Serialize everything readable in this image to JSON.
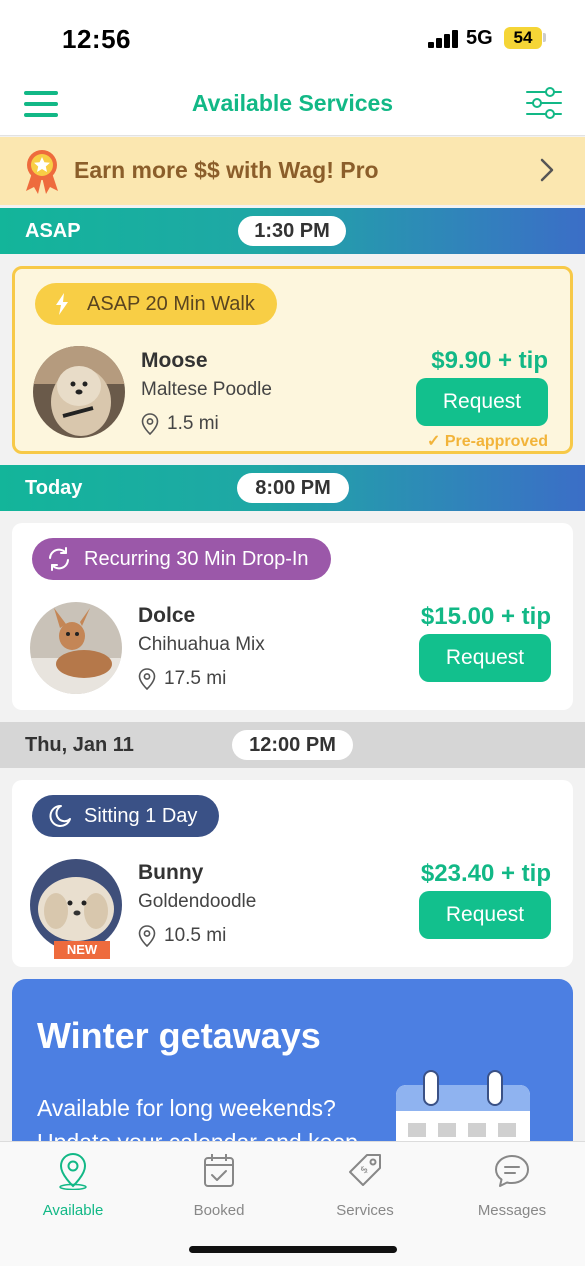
{
  "status_bar": {
    "time": "12:56",
    "network": "5G",
    "battery": "54"
  },
  "header": {
    "title": "Available Services"
  },
  "promo": {
    "text": "Earn more $$ with Wag! Pro"
  },
  "sections": [
    {
      "label": "ASAP",
      "time": "1:30 PM",
      "card": {
        "service": "ASAP 20 Min Walk",
        "dog_name": "Moose",
        "breed": "Maltese Poodle",
        "distance": "1.5 mi",
        "price": "$9.90 + tip",
        "button": "Request",
        "status": "✓ Pre-approved"
      }
    },
    {
      "label": "Today",
      "time": "8:00 PM",
      "card": {
        "service": "Recurring 30 Min Drop-In",
        "dog_name": "Dolce",
        "breed": "Chihuahua Mix",
        "distance": "17.5 mi",
        "price": "$15.00 + tip",
        "button": "Request"
      }
    },
    {
      "label": "Thu, Jan 11",
      "time": "12:00 PM",
      "card": {
        "service": "Sitting 1 Day",
        "dog_name": "Bunny",
        "breed": "Goldendoodle",
        "distance": "10.5 mi",
        "price": "$23.40 + tip",
        "button": "Request",
        "badge": "NEW"
      }
    }
  ],
  "winter_promo": {
    "title": "Winter getaways",
    "body": "Available for long weekends? Update your calendar and keep"
  },
  "tabs": [
    {
      "label": "Available",
      "icon": "map-pin-icon",
      "active": true
    },
    {
      "label": "Booked",
      "icon": "calendar-check-icon",
      "active": false
    },
    {
      "label": "Services",
      "icon": "price-tag-icon",
      "active": false
    },
    {
      "label": "Messages",
      "icon": "chat-bubble-icon",
      "active": false
    }
  ],
  "colors": {
    "brand": "#12b886",
    "promo_bg": "#fbe7b0",
    "asap_card_bg": "#fdf6dd",
    "asap_tag": "#f8ce45",
    "recurring_tag": "#9b58a9",
    "sitting_tag": "#3a5186",
    "winter_bg": "#4c7fe2"
  }
}
